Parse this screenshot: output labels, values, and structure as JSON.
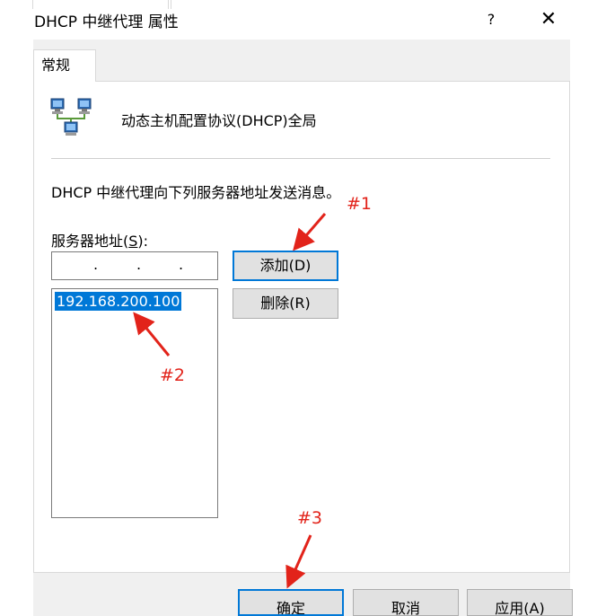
{
  "window": {
    "title": "DHCP 中继代理 属性",
    "help_glyph": "?",
    "close_glyph": "✕"
  },
  "tabs": [
    {
      "label": "常规",
      "selected": true
    }
  ],
  "header": {
    "icon": "network-computers-icon",
    "label": "动态主机配置协议(DHCP)全局"
  },
  "description": "DHCP 中继代理向下列服务器地址发送消息。",
  "server_address": {
    "label": "服务器地址(S):",
    "input_value": ". . .",
    "list": [
      "192.168.200.100"
    ],
    "selected_index": 0
  },
  "buttons": {
    "add": "添加(D)",
    "delete": "删除(R)",
    "ok": "确定",
    "cancel": "取消",
    "apply": "应用(A)"
  },
  "annotations": {
    "color": "#e2231a",
    "labels": [
      "#1",
      "#2",
      "#3"
    ]
  },
  "colors": {
    "selection": "#0078d7",
    "dialog_bg": "#f0f0f0"
  }
}
